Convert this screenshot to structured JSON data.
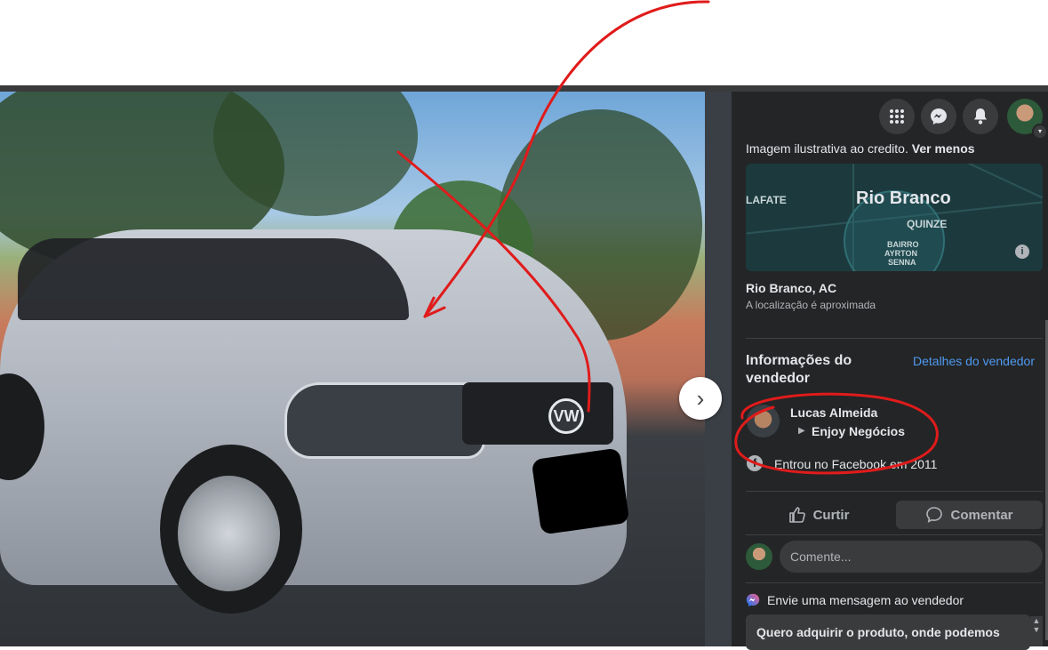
{
  "listing": {
    "description_tail": "Imagem ilustrativa ao credito.",
    "see_less": "Ver menos"
  },
  "map": {
    "city_label": "Rio Branco",
    "labels": [
      "LAFATE",
      "QUINZE",
      "BAIRRO",
      "AYRTON",
      "SENNA"
    ],
    "location_title": "Rio Branco, AC",
    "location_note": "A localização é aproximada"
  },
  "seller": {
    "section_title_line1": "Informações do",
    "section_title_line2": "vendedor",
    "details_link": "Detalhes do vendedor",
    "name": "Lucas Almeida",
    "store": "Enjoy Negócios",
    "joined": "Entrou no Facebook em 2011"
  },
  "actions": {
    "like": "Curtir",
    "comment": "Comentar",
    "comment_placeholder": "Comente..."
  },
  "message": {
    "title": "Envie uma mensagem ao vendedor",
    "draft": "Quero adquirir o produto, onde podemos"
  },
  "car": {
    "badge": "VW"
  },
  "icons": {
    "menu": "grid-menu-icon",
    "messenger": "messenger-icon",
    "notifications": "bell-icon",
    "next": "chevron-right-icon"
  },
  "colors": {
    "panel_bg": "#242526",
    "link": "#4e9af1",
    "annotation_red": "#e01b1b"
  }
}
